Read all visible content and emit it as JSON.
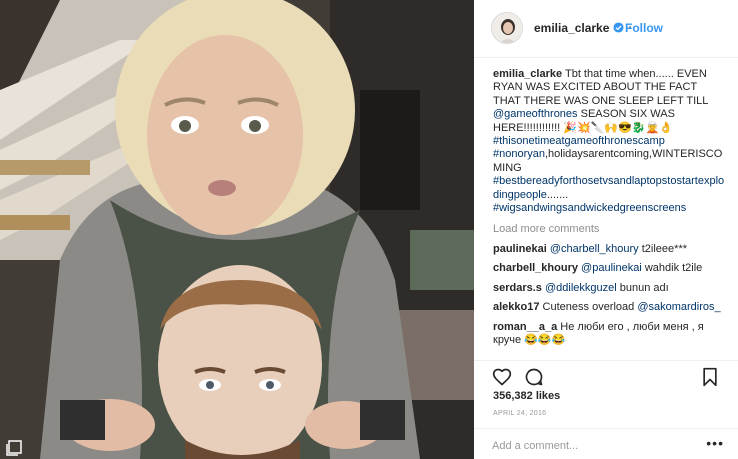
{
  "post": {
    "username": "emilia_clarke",
    "follow_label": "Follow",
    "caption_user": "emilia_clarke",
    "caption_text": " Tbt that time when...... EVEN RYAN WAS EXCITED ABOUT THE FACT THAT THERE WAS ONE SLEEP LEFT TILL ",
    "caption_mention": "@gameofthrones",
    "caption_text2": " SEASON SIX WAS HERE!!!!!!!!!!!! 🎉💥🔪🙌😎🐉🧝👌 ",
    "caption_hashtag1": "#thisonetimeatgameofthronescamp",
    "caption_hashtag2": " #nonoryan",
    "caption_text3": ",holidaysarentcoming,WINTERISCOMING ",
    "caption_hashtag3": "#bestbereadyforthosetvsandlaptopstostartexplodingpeople",
    "caption_text4": "....... ",
    "caption_hashtag4": "#wigsandwingsandwickedgreenscreens",
    "load_more_label": "Load more comments",
    "comments": [
      {
        "user": "paulinekai",
        "mention": "@charbell_khoury",
        "text": " t2ileee***"
      },
      {
        "user": "charbell_khoury",
        "mention": "@paulinekai",
        "text": " wahdik t2ile"
      },
      {
        "user": "serdars.s",
        "mention": "@ddilekkguzel",
        "text": " bunun adı"
      },
      {
        "user": "alekko17",
        "mention": "",
        "text": "Cuteness overload ",
        "mention_after": "@sakomardiros_"
      },
      {
        "user": "roman__a_a",
        "mention": "",
        "text": "Не люби его , люби меня , я круче 😂😂😂"
      }
    ],
    "likes": "356,382 likes",
    "date": "APRIL 24, 2016",
    "add_comment_placeholder": "Add a comment...",
    "more_options": "•••"
  },
  "icons": {
    "photo": "photo-stack-icon",
    "verified": "verified-badge-icon",
    "like": "heart-outline-icon",
    "comment": "comment-bubble-icon",
    "save": "bookmark-icon"
  },
  "colors": {
    "link": "#003569",
    "follow": "#3897f0",
    "muted": "#8e8e8e"
  }
}
